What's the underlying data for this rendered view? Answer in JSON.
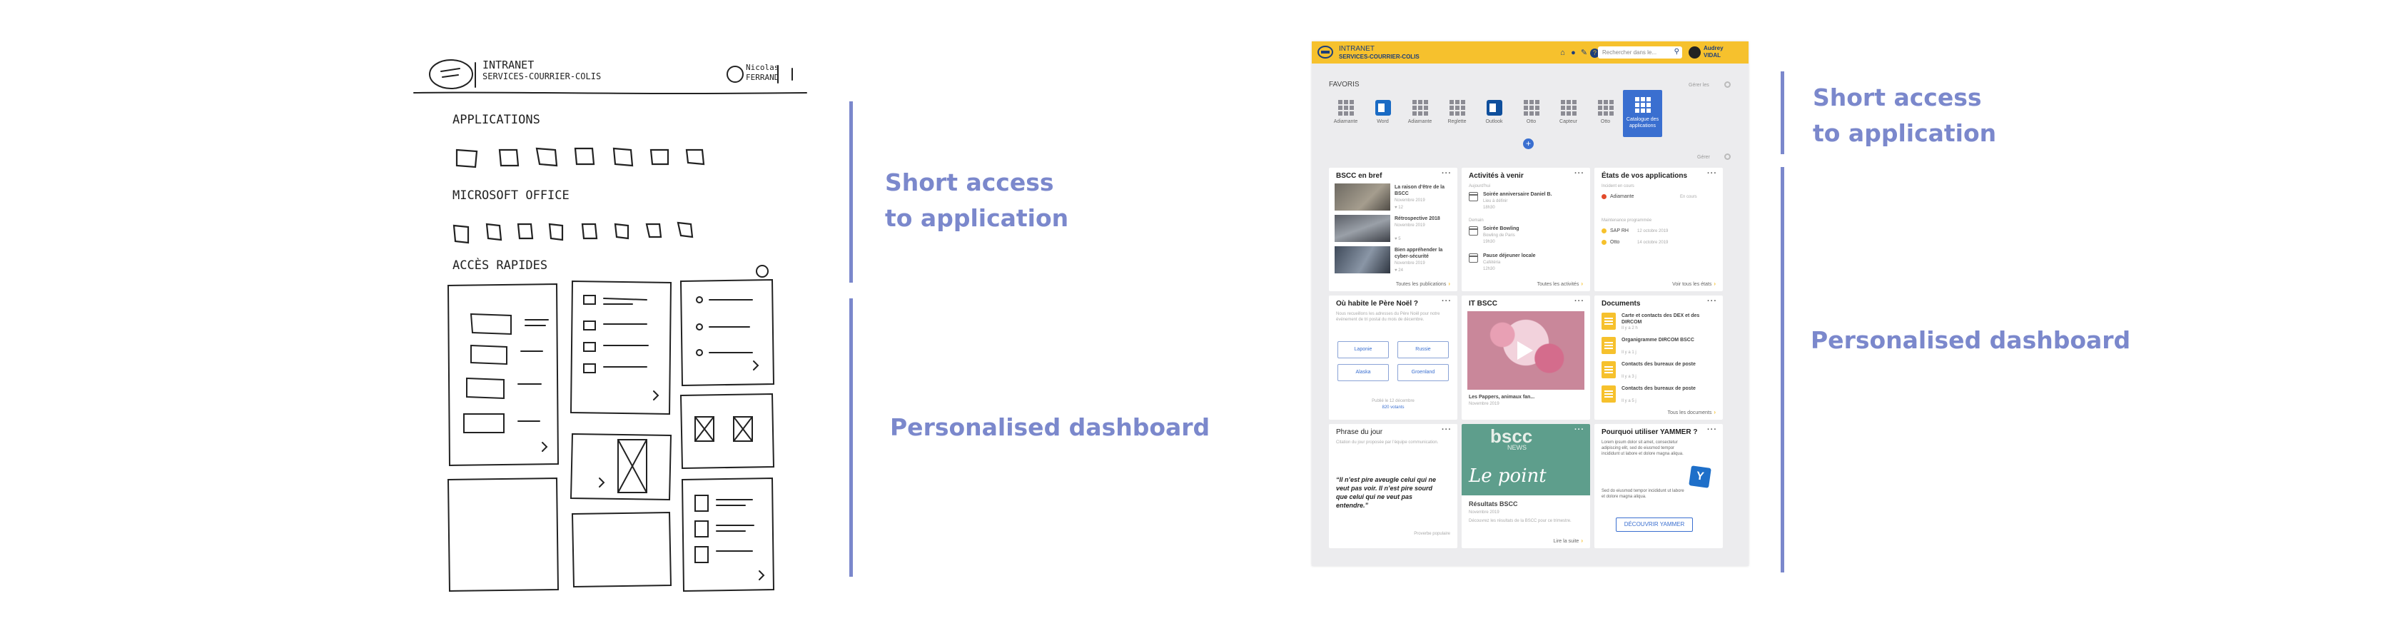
{
  "sketch": {
    "title_line1": "INTRANET",
    "title_line2": "SERVICES-COURRIER-COLIS",
    "user_line1": "Nicolas",
    "user_line2": "FERRAND",
    "section_applications": "APPLICATIONS",
    "section_office": "MICROSOFT OFFICE",
    "section_quick": "ACCÈS RAPIDES"
  },
  "callouts": {
    "left_short_access": [
      "Short access",
      "to application"
    ],
    "left_dashboard": "Personalised dashboard",
    "right_short_access": [
      "Short access",
      "to application"
    ],
    "right_dashboard": "Personalised dashboard"
  },
  "colors": {
    "accent_line": "#7b88cc",
    "topbar": "#f6c12d",
    "primary_blue": "#3a6fd0"
  },
  "mock": {
    "header": {
      "brand_line1": "INTRANET",
      "brand_line2": "SERVICES-COURRIER-COLIS",
      "icons": [
        "home-icon",
        "bell-icon",
        "tool-icon",
        "help-icon"
      ],
      "search_placeholder": "Rechercher dans le...",
      "user_line1": "Audrey",
      "user_line2": "VIDAL"
    },
    "favorites": {
      "title": "FAVORIS",
      "settings": "Gérer les",
      "tiles": [
        {
          "label": "Adiamante",
          "icon": "grid"
        },
        {
          "label": "Word",
          "icon": "ms"
        },
        {
          "label": "Adiamante",
          "icon": "grid"
        },
        {
          "label": "Reglette",
          "icon": "grid"
        },
        {
          "label": "Outlook",
          "icon": "ms"
        },
        {
          "label": "Otto",
          "icon": "grid"
        },
        {
          "label": "Capteur",
          "icon": "grid"
        },
        {
          "label": "Otto",
          "icon": "grid"
        }
      ],
      "catalogue_line1": "Catalogue des",
      "catalogue_line2": "applications",
      "widgets_settings": "Gérer"
    },
    "bscc": {
      "title": "BSCC en bref",
      "items": [
        {
          "title": "La raison d’être de la BSCC",
          "date": "Novembre 2019",
          "likes": "12"
        },
        {
          "title": "Rétrospective 2018",
          "date": "Novembre 2019",
          "likes": "5"
        },
        {
          "title": "Bien appréhender la cyber-sécurité",
          "date": "Novembre 2019",
          "likes": "24"
        }
      ],
      "footer": "Toutes les publications"
    },
    "activites": {
      "title": "Activités à venir",
      "group1": "Aujourd’hui",
      "group2": "Demain",
      "items": [
        {
          "title": "Soirée anniversaire Daniel B.",
          "meta1": "Lieu à définir",
          "meta2": "18h30"
        },
        {
          "title": "Soirée Bowling",
          "meta1": "Bowling de Paris",
          "meta2": "19h30"
        },
        {
          "title": "Pause déjeuner locale",
          "meta1": "Cafétéria",
          "meta2": "12h30"
        }
      ],
      "footer": "Toutes les activités"
    },
    "etats": {
      "title": "États de vos applications",
      "sub1": "Incident en cours",
      "sub2": "Maintenance programmée",
      "items": [
        {
          "name": "Adiamante",
          "status": "En cours",
          "color": "#e24a2b"
        },
        {
          "name": "SAP RH",
          "status": "12 octobre 2019",
          "color": "#f6c12d"
        },
        {
          "name": "Otto",
          "status": "14 octobre 2019",
          "color": "#f6c12d"
        }
      ],
      "footer": "Voir tous les états"
    },
    "pere_noel": {
      "title": "Où habite le Père Noël ?",
      "body": "Nous recueillons les adresses du Père Noël pour notre événement de tri postal du mois de décembre.",
      "options": [
        "Laponie",
        "Russie",
        "Alaska",
        "Groenland"
      ],
      "meta1": "Publié le 12 décembre",
      "meta2": "820 votants"
    },
    "it_bscc": {
      "title": "IT BSCC",
      "video_title": "Les Pappers, animaux fan...",
      "date": "Novembre 2019"
    },
    "documents": {
      "title": "Documents",
      "items": [
        {
          "title": "Carte et contacts des DEX et des DIRCOM",
          "meta": "Il y a 2 h"
        },
        {
          "title": "Organigramme DIRCOM BSCC",
          "meta": "Il y a 1 j"
        },
        {
          "title": "Contacts des bureaux de poste",
          "meta": "Il y a 3 j"
        },
        {
          "title": "Contacts des bureaux de poste",
          "meta": "Il y a 5 j"
        }
      ],
      "footer": "Tous les documents"
    },
    "phrase": {
      "title": "Phrase du jour",
      "intro": "Citation du jour proposée par l’équipe communication.",
      "quote": "“Il n’est pire aveugle celui qui ne veut pas voir. Il n’est pire sourd que celui qui ne veut pas entendre.”",
      "source": "Proverbe populaire"
    },
    "news": {
      "image_text1": "bscc",
      "image_text2": "NEWS",
      "image_text3": "Le point",
      "title": "Résultats BSCC",
      "date": "Novembre 2019",
      "body": "Découvrez les résultats de la BSCC pour ce trimestre.",
      "link": "Lire la suite"
    },
    "yammer": {
      "title": "Pourquoi utiliser YAMMER ?",
      "body1": "Lorem ipsum dolor sit amet, consectetur adipiscing elit, sed do eiusmod tempor incididunt ut labore et dolore magna aliqua.",
      "body2": "Sed do eiusmod tempor incididunt ut labore et dolore magna aliqua.",
      "button": "DÉCOUVRIR YAMMER",
      "logo_letter": "Y"
    }
  }
}
